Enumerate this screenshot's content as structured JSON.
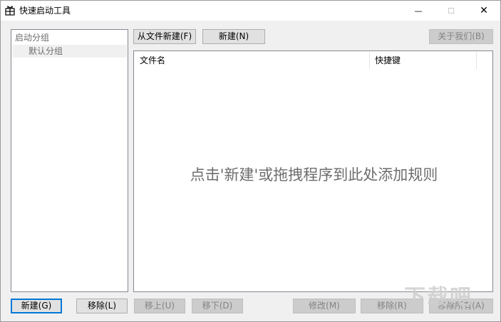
{
  "window": {
    "title": "快速启动工具",
    "controls": {
      "minimize": "—",
      "maximize": "☐",
      "close": "✕"
    }
  },
  "toolbar": {
    "new_from_file": "从文件新建(F)",
    "new": "新建(N)",
    "about": "关于我们(B)"
  },
  "groups": {
    "root": "启动分组",
    "children": [
      "默认分组"
    ]
  },
  "list": {
    "columns": [
      "文件名",
      "快捷键"
    ],
    "empty_hint": "点击'新建'或拖拽程序到此处添加规则"
  },
  "bottom_left": {
    "new": "新建(G)",
    "remove": "移除(L)",
    "move_up": "移上(U)",
    "move_down": "移下(D)"
  },
  "bottom_right": {
    "edit": "修改(M)",
    "remove": "移除(R)",
    "remove_all": "移除所有(A)"
  },
  "watermark": {
    "text": "下载吧"
  }
}
